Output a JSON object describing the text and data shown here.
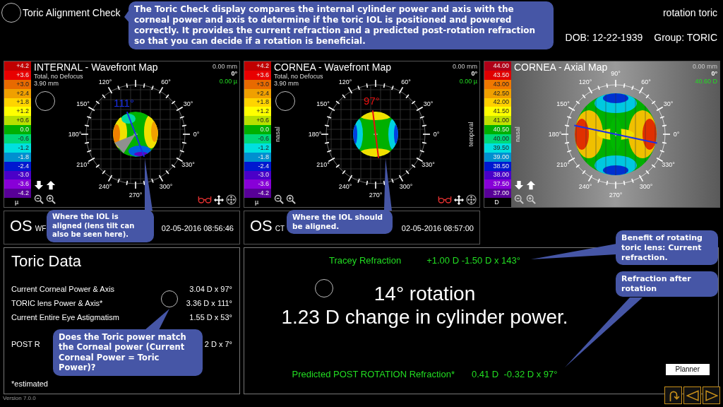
{
  "header": {
    "title": "Toric Alignment Check",
    "program": "rotation toric",
    "dob": "DOB: 12-22-1939",
    "group": "Group: TORIC"
  },
  "intro_callout": "The Toric Check display compares the internal cylinder power and axis with the corneal power and axis to determine if the toric IOL is positioned and powered correctly.  It provides the current refraction and a predicted post-rotation refraction so that you can decide if a rotation is beneficial.",
  "maps": [
    {
      "kind": "wavefront",
      "title": "INTERNAL - Wavefront Map",
      "subtitle": "Total, no Defocus",
      "diameter": "3.90 mm",
      "readouts": [
        "0.00 mm",
        "0°",
        "0.00 µ"
      ],
      "axis_label": "111°",
      "color": "#1a30e8",
      "scale_unit": "µ",
      "scale": [
        {
          "value": "+4.2",
          "color": "#c00000"
        },
        {
          "value": "+3.6",
          "color": "#e80000"
        },
        {
          "value": "+3.0",
          "color": "#e86a00"
        },
        {
          "value": "+2.4",
          "color": "#f0a000"
        },
        {
          "value": "+1.8",
          "color": "#ffd400"
        },
        {
          "value": "+1.2",
          "color": "#ffff00"
        },
        {
          "value": "+0.6",
          "color": "#b8e000"
        },
        {
          "value": "0.0",
          "color": "#00b000"
        },
        {
          "value": "-0.6",
          "color": "#00d878"
        },
        {
          "value": "-1.2",
          "color": "#00e0e0"
        },
        {
          "value": "-1.8",
          "color": "#0090d0"
        },
        {
          "value": "-2.4",
          "color": "#0018d0"
        },
        {
          "value": "-3.0",
          "color": "#4a00c8"
        },
        {
          "value": "-3.6",
          "color": "#8800d8"
        },
        {
          "value": "-4.2",
          "color": "#580098"
        }
      ],
      "dial_labels": [
        {
          "text": "0°",
          "kind": "e"
        },
        {
          "text": "30°",
          "kind": "ene"
        },
        {
          "text": "60°",
          "kind": "nne"
        },
        {
          "text": "120°",
          "kind": "nnw"
        },
        {
          "text": "150°",
          "kind": "wnw"
        },
        {
          "text": "180°",
          "kind": "w"
        },
        {
          "text": "210°",
          "kind": "wsw"
        },
        {
          "text": "240°",
          "kind": "ssw"
        },
        {
          "text": "270°",
          "kind": "s"
        },
        {
          "text": "300°",
          "kind": "sse"
        },
        {
          "text": "330°",
          "kind": "ese"
        }
      ],
      "tools": [
        {
          "kind": "arrow-down"
        },
        {
          "kind": "arrow-up"
        },
        {
          "kind": "zoom-out"
        },
        {
          "kind": "zoom-in"
        },
        {
          "kind": "glasses"
        },
        {
          "kind": "move"
        },
        {
          "kind": "target"
        }
      ],
      "callout": "Where the IOL is aligned (lens tilt can also be seen here)."
    },
    {
      "kind": "wavefront",
      "title": "CORNEA - Wavefront Map",
      "subtitle": "Total, no Defocus",
      "diameter": "3.90 mm",
      "readouts": [
        "0.00 mm",
        "0°",
        "0.00 µ"
      ],
      "axis_label": "97°",
      "color": "#e81010",
      "scale_unit": "µ",
      "scale": [
        {
          "value": "+4.2",
          "color": "#c00000"
        },
        {
          "value": "+3.6",
          "color": "#e80000"
        },
        {
          "value": "+3.0",
          "color": "#e86a00"
        },
        {
          "value": "+2.4",
          "color": "#f0a000"
        },
        {
          "value": "+1.8",
          "color": "#ffd400"
        },
        {
          "value": "+1.2",
          "color": "#ffff00"
        },
        {
          "value": "+0.6",
          "color": "#b8e000"
        },
        {
          "value": "0.0",
          "color": "#00b000"
        },
        {
          "value": "-0.6",
          "color": "#00d878"
        },
        {
          "value": "-1.2",
          "color": "#00e0e0"
        },
        {
          "value": "-1.8",
          "color": "#0090d0"
        },
        {
          "value": "-2.4",
          "color": "#0018d0"
        },
        {
          "value": "-3.0",
          "color": "#4a00c8"
        },
        {
          "value": "-3.6",
          "color": "#8800d8"
        },
        {
          "value": "-4.2",
          "color": "#580098"
        }
      ],
      "side_labels": [
        {
          "text": "nasal",
          "kind": "left"
        },
        {
          "text": "temporal",
          "kind": "right"
        }
      ],
      "dial_labels": [
        {
          "text": "0°",
          "kind": "e"
        },
        {
          "text": "30°",
          "kind": "ene"
        },
        {
          "text": "60°",
          "kind": "nne"
        },
        {
          "text": "120°",
          "kind": "nnw"
        },
        {
          "text": "150°",
          "kind": "wnw"
        },
        {
          "text": "180°",
          "kind": "w"
        },
        {
          "text": "210°",
          "kind": "wsw"
        },
        {
          "text": "240°",
          "kind": "ssw"
        },
        {
          "text": "270°",
          "kind": "s"
        },
        {
          "text": "300°",
          "kind": "sse"
        },
        {
          "text": "330°",
          "kind": "ese"
        }
      ],
      "tools": [
        {
          "kind": "zoom-out"
        },
        {
          "kind": "zoom-in"
        },
        {
          "kind": "glasses"
        },
        {
          "kind": "move"
        },
        {
          "kind": "target"
        }
      ],
      "callout": "Where the IOL should be aligned."
    },
    {
      "kind": "axial",
      "title": "CORNEA - Axial Map",
      "readouts": [
        "0.00 mm",
        "0°",
        "40.60 D"
      ],
      "color": "#1a30e8",
      "scale_unit": "D",
      "scale": [
        {
          "value": "44.00",
          "color": "#b00018"
        },
        {
          "value": "43.50",
          "color": "#e00000"
        },
        {
          "value": "43.00",
          "color": "#f07800"
        },
        {
          "value": "42.50",
          "color": "#f0a000"
        },
        {
          "value": "42.00",
          "color": "#ffd000"
        },
        {
          "value": "41.50",
          "color": "#ffff00"
        },
        {
          "value": "41.00",
          "color": "#c0e000"
        },
        {
          "value": "40.50",
          "color": "#00b000"
        },
        {
          "value": "40.00",
          "color": "#00d878"
        },
        {
          "value": "39.50",
          "color": "#00e0e0"
        },
        {
          "value": "39.00",
          "color": "#0090d0"
        },
        {
          "value": "38.50",
          "color": "#0018d0"
        },
        {
          "value": "38.00",
          "color": "#4a00c8"
        },
        {
          "value": "37.50",
          "color": "#8800d8"
        },
        {
          "value": "37.00",
          "color": "#580098"
        }
      ],
      "side_labels": [
        {
          "text": "nasal",
          "kind": "left"
        }
      ],
      "dial_labels": [
        {
          "text": "0°",
          "kind": "e"
        },
        {
          "text": "30°",
          "kind": "ene"
        },
        {
          "text": "60°",
          "kind": "nne"
        },
        {
          "text": "90°",
          "kind": "n"
        },
        {
          "text": "120°",
          "kind": "nnw"
        },
        {
          "text": "150°",
          "kind": "wnw"
        },
        {
          "text": "180°",
          "kind": "w"
        },
        {
          "text": "210°",
          "kind": "wsw"
        },
        {
          "text": "240°",
          "kind": "ssw"
        },
        {
          "text": "270°",
          "kind": "s"
        },
        {
          "text": "300°",
          "kind": "sse"
        },
        {
          "text": "330°",
          "kind": "ese"
        }
      ],
      "tools": [
        {
          "kind": "arrow-down"
        },
        {
          "kind": "arrow-up"
        },
        {
          "kind": "zoom-out"
        },
        {
          "kind": "zoom-in"
        }
      ]
    }
  ],
  "exams": [
    {
      "eye": "OS",
      "type": "WF",
      "datetime": "02-05-2016 08:56:46"
    },
    {
      "eye": "OS",
      "type": "CT",
      "datetime": "02-05-2016 08:57:00"
    }
  ],
  "toric_data": {
    "title": "Toric Data",
    "rows": [
      {
        "label": "Current Corneal Power & Axis",
        "value": "3.04 D x 97°"
      },
      {
        "label": "TORIC lens Power & Axis*",
        "value": "3.36 D x 111°"
      },
      {
        "label": "Current Entire Eye Astigmatism",
        "value": "1.55 D x 53°"
      }
    ],
    "post_label": "POST R",
    "post_value": "2 D x 7°",
    "footnote": "*estimated",
    "callout": "Does the Toric power match the Corneal power (Current Corneal Power = Toric Power)?"
  },
  "refraction": {
    "current_label": "Tracey Refraction",
    "current_value": "+1.00 D -1.50 D x 143°",
    "rotation": "14° rotation",
    "change": "1.23 D change in cylinder power.",
    "predicted_label": "Predicted POST ROTATION Refraction*",
    "predicted_value": "0.41 D  -0.32 D x 97°",
    "callouts": [
      "Benefit of rotating toric lens: Current refraction.",
      "Refraction after rotation"
    ]
  },
  "planner_button": "Planner",
  "nav_buttons": [
    {
      "kind": "return"
    },
    {
      "kind": "back"
    },
    {
      "kind": "forward"
    }
  ],
  "version": "Version 7.0.0"
}
